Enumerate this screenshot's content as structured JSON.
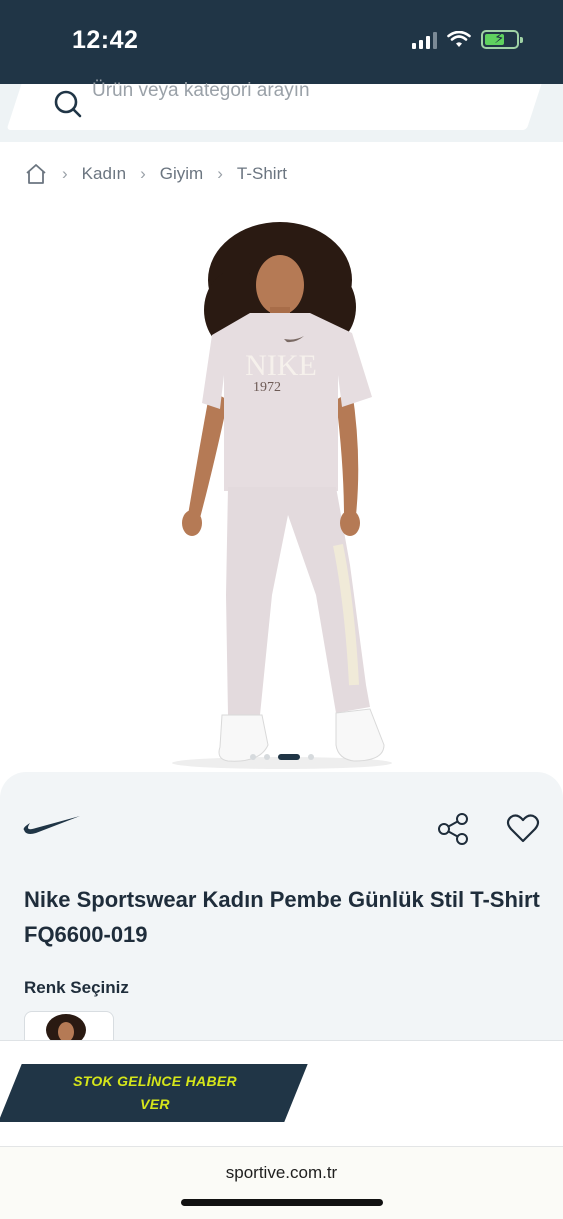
{
  "status_bar": {
    "time": "12:42"
  },
  "search": {
    "placeholder": "Ürün veya kategori arayın"
  },
  "breadcrumb": {
    "items": [
      "Kadın",
      "Giyim",
      "T-Shirt"
    ]
  },
  "gallery": {
    "image_alt": "Nike women's pink t-shirt and sweatpants",
    "print_text": "NIKE",
    "print_year": "1972",
    "total_slides": 4,
    "active_slide": 3
  },
  "product": {
    "brand": "Nike",
    "title": "Nike Sportswear Kadın Pembe Günlük Stil T-Shirt FQ6600-019",
    "color_label": "Renk Seçiniz"
  },
  "cta": {
    "stock_line1": "STOK GELİNCE HABER",
    "stock_line2": "VER"
  },
  "browser": {
    "url": "sportive.com.tr"
  },
  "colors": {
    "navy": "#203546",
    "accent_lime": "#d5e61a",
    "card_bg": "#f2f5f7"
  }
}
